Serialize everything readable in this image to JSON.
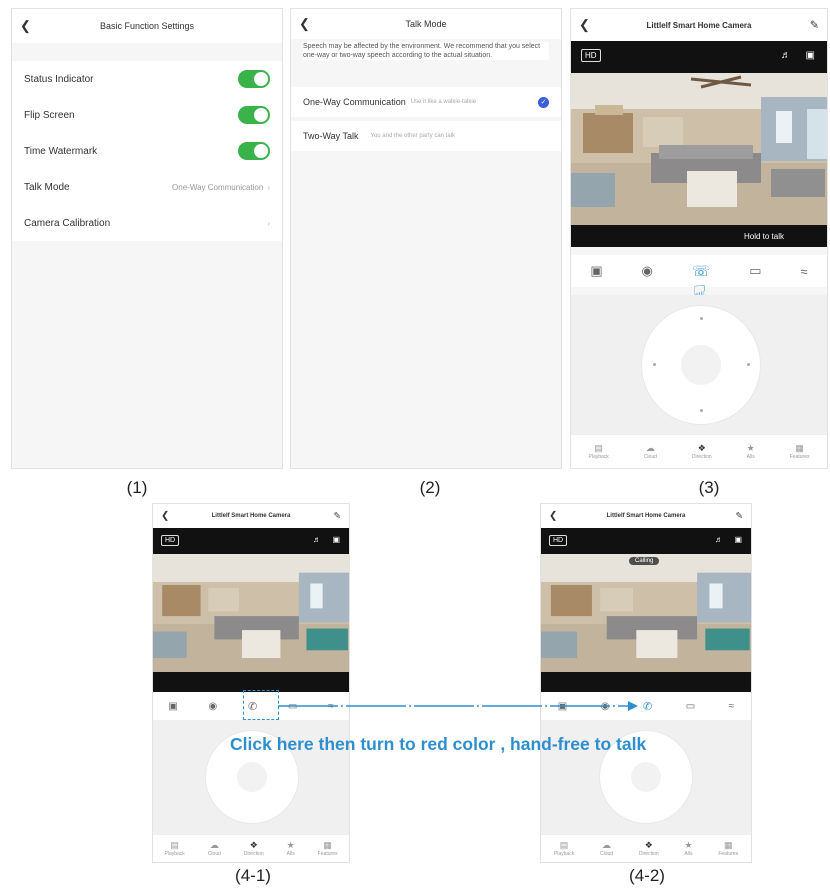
{
  "captions": [
    "(1)",
    "(2)",
    "(3)",
    "(4-1)",
    "(4-2)"
  ],
  "screen1": {
    "title": "Basic Function Settings",
    "rows": [
      {
        "label": "Status Indicator",
        "toggle": true
      },
      {
        "label": "Flip Screen",
        "toggle": true
      },
      {
        "label": "Time Watermark",
        "toggle": true
      },
      {
        "label": "Talk Mode",
        "value": "One-Way Communication"
      },
      {
        "label": "Camera Calibration",
        "value": ""
      }
    ]
  },
  "screen2": {
    "title": "Talk Mode",
    "description": "Speech may be affected by the environment. We recommend that you select one-way or two-way speech according to the actual situation.",
    "options": [
      {
        "label": "One-Way Communication",
        "hint": "Use it like a walkie-talkie",
        "selected": true
      },
      {
        "label": "Two-Way Talk",
        "hint": "You and the other party can talk",
        "selected": false
      }
    ]
  },
  "camera": {
    "title": "Littlelf Smart Home Camera",
    "hd": "HD",
    "hold_to_talk": "Hold to talk",
    "calling": "Calling",
    "nav": [
      "Playback",
      "Cloud",
      "Direction",
      "Alls",
      "Features"
    ]
  },
  "annotation": {
    "text": "Click here then turn to red color , hand-free to talk",
    "color": "#2e8fce"
  },
  "colors": {
    "toggle_green": "#3ab34a",
    "accent_blue": "#2e8fce",
    "check_blue": "#3a5fd6"
  }
}
